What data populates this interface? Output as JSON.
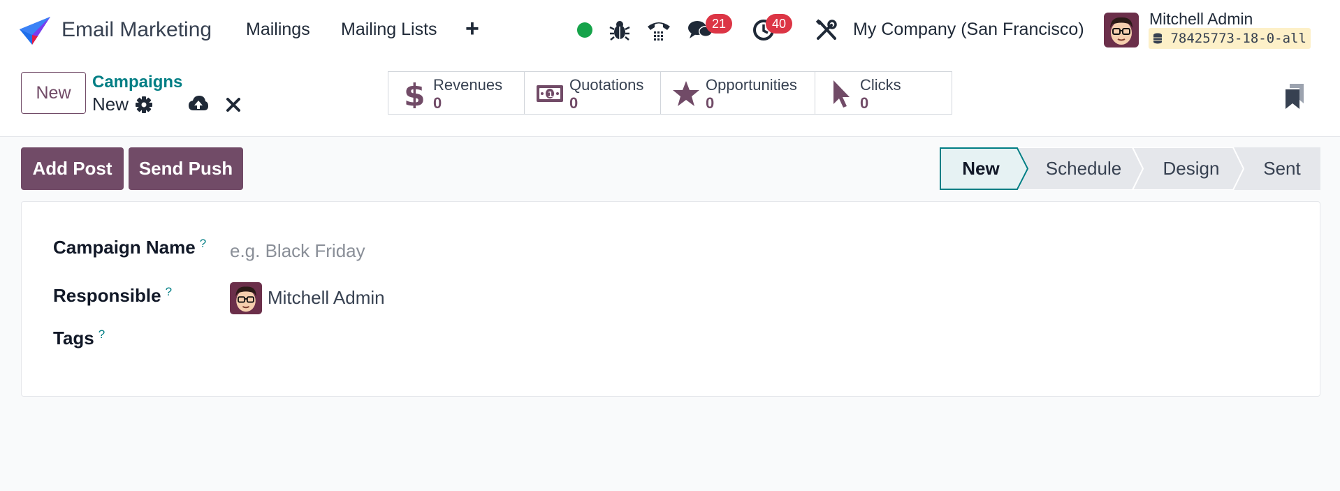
{
  "navbar": {
    "app_name": "Email Marketing",
    "menus": [
      "Mailings",
      "Mailing Lists"
    ],
    "plus": "+",
    "messages_count": "21",
    "activities_count": "40",
    "company": "My Company (San Francisco)",
    "user_name": "Mitchell Admin",
    "db_name": "78425773-18-0-all",
    "presence_color": "#16a34a"
  },
  "control_panel": {
    "new_button": "New",
    "breadcrumb_parent": "Campaigns",
    "breadcrumb_current": "New",
    "stats": [
      {
        "label": "Revenues",
        "value": "0",
        "icon": "dollar-icon"
      },
      {
        "label": "Quotations",
        "value": "0",
        "icon": "banknote-icon"
      },
      {
        "label": "Opportunities",
        "value": "0",
        "icon": "star-icon"
      },
      {
        "label": "Clicks",
        "value": "0",
        "icon": "cursor-icon"
      }
    ]
  },
  "actions": {
    "add_post": "Add Post",
    "send_push": "Send Push"
  },
  "statusbar": {
    "stages": [
      "New",
      "Schedule",
      "Design",
      "Sent"
    ],
    "active_index": 0
  },
  "form": {
    "campaign_name_label": "Campaign Name",
    "campaign_name_placeholder": "e.g. Black Friday",
    "campaign_name_value": "",
    "responsible_label": "Responsible",
    "responsible_value": "Mitchell Admin",
    "tags_label": "Tags",
    "help_mark": "?"
  },
  "colors": {
    "brand": "#714b67",
    "link": "#017e84",
    "badge": "#dc3545",
    "active_stage_bg": "#e6f2f3"
  }
}
